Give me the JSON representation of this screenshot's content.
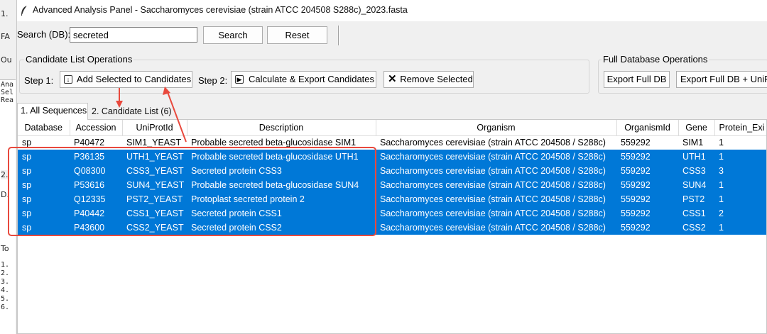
{
  "background_window": {
    "fragments": [
      "1.",
      "FA",
      "Ou",
      "2.",
      "D.",
      "To"
    ],
    "mono_lines": [
      "Ana",
      "Sel",
      "Rea"
    ],
    "numbered_lines": [
      "1.",
      "2.",
      "3.",
      "4.",
      "5.",
      "6."
    ]
  },
  "window": {
    "title": "Advanced Analysis Panel - Saccharomyces cerevisiae (strain ATCC 204508  S288c)_2023.fasta",
    "icon": "feather-icon"
  },
  "search": {
    "label": "Search (DB):",
    "value": "secreted",
    "search_button": "Search",
    "reset_button": "Reset"
  },
  "candidate_ops": {
    "group_title": "Candidate List Operations",
    "step1_label": "Step 1:",
    "add_button": "Add Selected to Candidates",
    "add_icon": "download-icon",
    "step2_label": "Step 2:",
    "calc_button": "Calculate & Export Candidates",
    "calc_icon": "play-icon",
    "remove_button": "Remove Selected",
    "remove_icon": "x-icon"
  },
  "full_ops": {
    "group_title": "Full Database Operations",
    "export_button": "Export Full DB",
    "export_uni_button": "Export Full DB + UniP"
  },
  "tabs": [
    {
      "label": "1. All Sequences",
      "active": true
    },
    {
      "label": "2. Candidate List (6)",
      "active": false
    }
  ],
  "table": {
    "columns": [
      "Database",
      "Accession",
      "UniProtId",
      "Description",
      "Organism",
      "OrganismId",
      "Gene",
      "Protein_Exi"
    ],
    "rows": [
      {
        "selected": false,
        "cells": [
          "sp",
          "P40472",
          "SIM1_YEAST",
          "Probable secreted beta-glucosidase SIM1",
          "Saccharomyces cerevisiae (strain ATCC 204508 / S288c)",
          "559292",
          "SIM1",
          "1"
        ]
      },
      {
        "selected": true,
        "cells": [
          "sp",
          "P36135",
          "UTH1_YEAST",
          "Probable secreted beta-glucosidase UTH1",
          "Saccharomyces cerevisiae (strain ATCC 204508 / S288c)",
          "559292",
          "UTH1",
          "1"
        ]
      },
      {
        "selected": true,
        "cells": [
          "sp",
          "Q08300",
          "CSS3_YEAST",
          "Secreted protein CSS3",
          "Saccharomyces cerevisiae (strain ATCC 204508 / S288c)",
          "559292",
          "CSS3",
          "3"
        ]
      },
      {
        "selected": true,
        "cells": [
          "sp",
          "P53616",
          "SUN4_YEAST",
          "Probable secreted beta-glucosidase SUN4",
          "Saccharomyces cerevisiae (strain ATCC 204508 / S288c)",
          "559292",
          "SUN4",
          "1"
        ]
      },
      {
        "selected": true,
        "cells": [
          "sp",
          "Q12335",
          "PST2_YEAST",
          "Protoplast secreted protein 2",
          "Saccharomyces cerevisiae (strain ATCC 204508 / S288c)",
          "559292",
          "PST2",
          "1"
        ]
      },
      {
        "selected": true,
        "cells": [
          "sp",
          "P40442",
          "CSS1_YEAST",
          "Secreted protein CSS1",
          "Saccharomyces cerevisiae (strain ATCC 204508 / S288c)",
          "559292",
          "CSS1",
          "2"
        ]
      },
      {
        "selected": true,
        "cells": [
          "sp",
          "P43600",
          "CSS2_YEAST",
          "Secreted protein CSS2",
          "Saccharomyces cerevisiae (strain ATCC 204508 / S288c)",
          "559292",
          "CSS2",
          "1"
        ]
      }
    ]
  },
  "annotation": {
    "color": "#e8493d"
  }
}
